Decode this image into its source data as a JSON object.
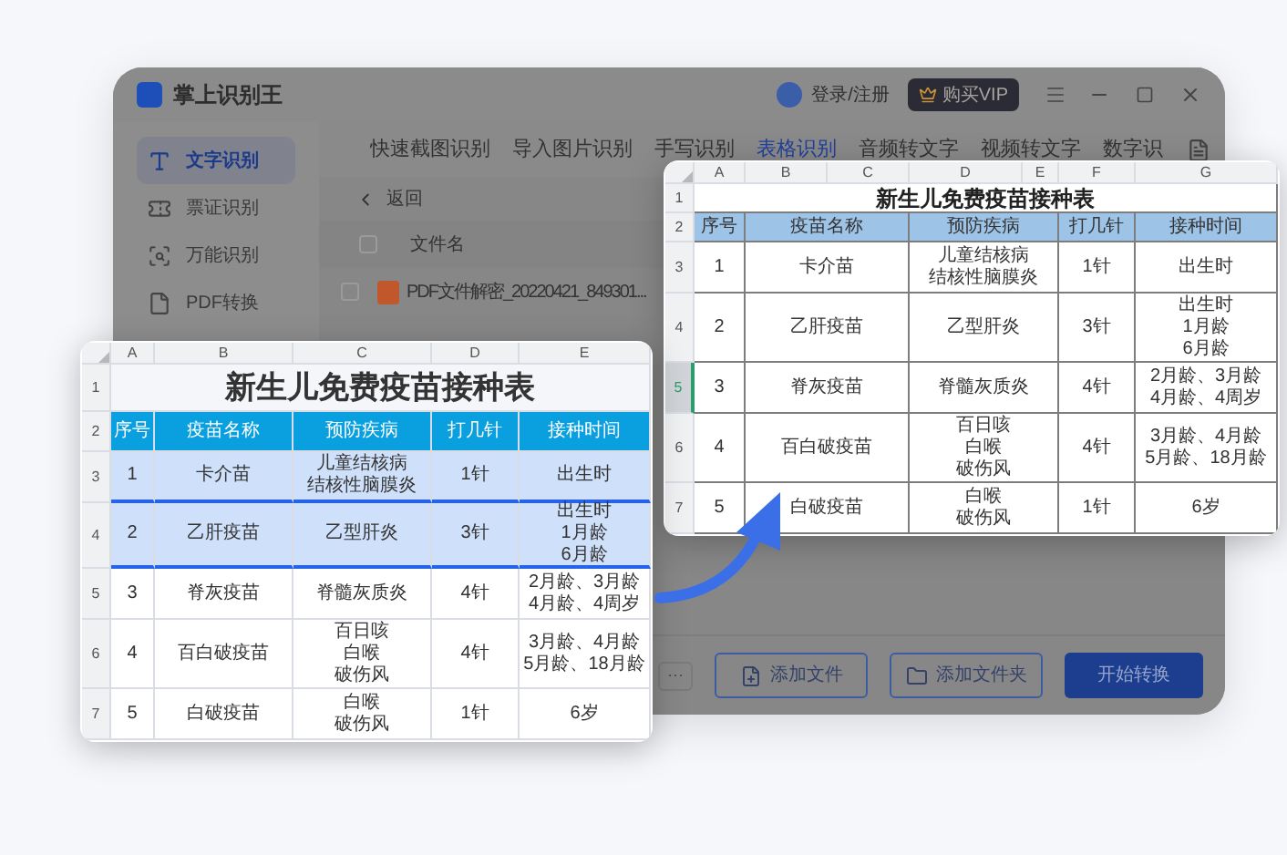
{
  "window": {
    "title": "掌上识别王",
    "account": "登录/注册",
    "vip": "购买VIP"
  },
  "sidebar": {
    "items": [
      {
        "label": "文字识别",
        "selected": true
      },
      {
        "label": "票证识别",
        "selected": false
      },
      {
        "label": "万能识别",
        "selected": false
      },
      {
        "label": "PDF转换",
        "selected": false
      }
    ]
  },
  "tabs": [
    {
      "label": "快速截图识别",
      "selected": false
    },
    {
      "label": "导入图片识别",
      "selected": false
    },
    {
      "label": "手写识别",
      "selected": false
    },
    {
      "label": "表格识别",
      "selected": true
    },
    {
      "label": "音频转文字",
      "selected": false
    },
    {
      "label": "视频转文字",
      "selected": false
    },
    {
      "label": "数字识",
      "selected": false
    }
  ],
  "back": "返回",
  "file_list": {
    "header": "文件名",
    "all_checked": false,
    "files": [
      {
        "name": "PDF文件解密_20220421_849301...",
        "checked": false
      }
    ]
  },
  "buttons": {
    "more": "···",
    "add_file": "添加文件",
    "add_folder": "添加文件夹",
    "start": "开始转换"
  },
  "sheets": [
    {
      "title": "新生儿免费疫苗接种表",
      "columns": [
        "A",
        "B",
        "C",
        "D",
        "E"
      ],
      "rows": [
        {
          "number": "1",
          "kind": "title",
          "scanned": false,
          "cells": []
        },
        {
          "number": "2",
          "kind": "header",
          "scanned": false,
          "cells": [
            [
              "序号"
            ],
            [
              "疫苗名称"
            ],
            [
              "预防疾病"
            ],
            [
              "打几针"
            ],
            [
              "接种时间"
            ]
          ]
        },
        {
          "number": "3",
          "kind": "data",
          "scanned": true,
          "cells": [
            [
              "1"
            ],
            [
              "卡介苗"
            ],
            [
              "儿童结核病",
              "结核性脑膜炎"
            ],
            [
              "1针"
            ],
            [
              "出生时"
            ]
          ]
        },
        {
          "number": "4",
          "kind": "data",
          "scanned": true,
          "cells": [
            [
              "2"
            ],
            [
              "乙肝疫苗"
            ],
            [
              "乙型肝炎"
            ],
            [
              "3针"
            ],
            [
              "出生时",
              "1月龄",
              "6月龄"
            ]
          ]
        },
        {
          "number": "5",
          "kind": "data",
          "scanned": false,
          "cells": [
            [
              "3"
            ],
            [
              "脊灰疫苗"
            ],
            [
              "脊髓灰质炎"
            ],
            [
              "4针"
            ],
            [
              "2月龄、3月龄",
              "4月龄、4周岁"
            ]
          ]
        },
        {
          "number": "6",
          "kind": "data",
          "scanned": false,
          "cells": [
            [
              "4"
            ],
            [
              "百白破疫苗"
            ],
            [
              "百日咳",
              "白喉",
              "破伤风"
            ],
            [
              "4针"
            ],
            [
              "3月龄、4月龄",
              "5月龄、18月龄"
            ]
          ]
        },
        {
          "number": "7",
          "kind": "data",
          "scanned": false,
          "cells": [
            [
              "5"
            ],
            [
              "白破疫苗"
            ],
            [
              "白喉",
              "破伤风"
            ],
            [
              "1针"
            ],
            [
              "6岁"
            ]
          ]
        }
      ]
    },
    {
      "title": "新生儿免费疫苗接种表",
      "columns": [
        "A",
        "B",
        "C",
        "D",
        "E",
        "F",
        "G"
      ],
      "rows": [
        {
          "number": "1",
          "kind": "title",
          "selected": false,
          "cells": []
        },
        {
          "number": "2",
          "kind": "header",
          "selected": false,
          "cells": [
            [
              "序号"
            ],
            [
              "疫苗名称"
            ],
            [],
            [
              "预防疾病"
            ],
            [],
            [
              "打几针"
            ],
            [
              "接种时间"
            ]
          ]
        },
        {
          "number": "3",
          "kind": "data",
          "selected": false,
          "cells": [
            [
              "1"
            ],
            [
              "卡介苗"
            ],
            [],
            [
              "儿童结核病",
              "结核性脑膜炎"
            ],
            [],
            [
              "1针"
            ],
            [
              "出生时"
            ]
          ]
        },
        {
          "number": "4",
          "kind": "data",
          "selected": false,
          "cells": [
            [
              "2"
            ],
            [
              "乙肝疫苗"
            ],
            [],
            [
              "乙型肝炎"
            ],
            [],
            [
              "3针"
            ],
            [
              "出生时",
              "1月龄",
              "6月龄"
            ]
          ]
        },
        {
          "number": "5",
          "kind": "data",
          "selected": true,
          "cells": [
            [
              "3"
            ],
            [
              "脊灰疫苗"
            ],
            [],
            [
              "脊髓灰质炎"
            ],
            [],
            [
              "4针"
            ],
            [
              "2月龄、3月龄",
              "4月龄、4周岁"
            ]
          ]
        },
        {
          "number": "6",
          "kind": "data",
          "selected": false,
          "cells": [
            [
              "4"
            ],
            [
              "百白破疫苗"
            ],
            [],
            [
              "百日咳",
              "白喉",
              "破伤风"
            ],
            [],
            [
              "4针"
            ],
            [
              "3月龄、4月龄",
              "5月龄、18月龄"
            ]
          ]
        },
        {
          "number": "7",
          "kind": "data",
          "selected": false,
          "cells": [
            [
              "5"
            ],
            [
              "白破疫苗"
            ],
            [],
            [
              "白喉",
              "破伤风"
            ],
            [],
            [
              "1针"
            ],
            [
              "6岁"
            ]
          ]
        }
      ]
    }
  ]
}
